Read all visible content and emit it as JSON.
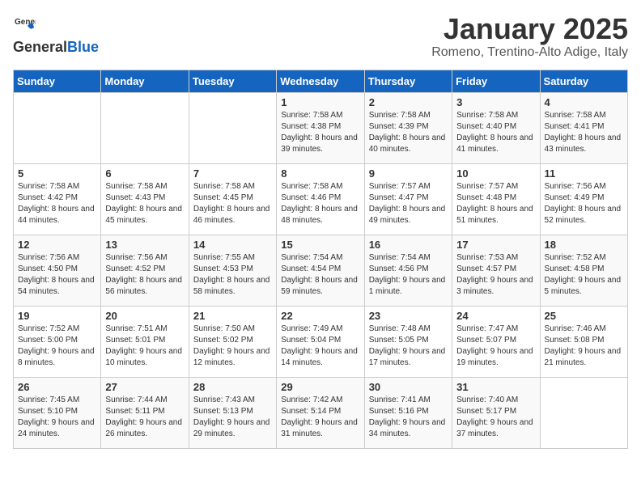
{
  "logo": {
    "general": "General",
    "blue": "Blue"
  },
  "title": "January 2025",
  "subtitle": "Romeno, Trentino-Alto Adige, Italy",
  "days_header": [
    "Sunday",
    "Monday",
    "Tuesday",
    "Wednesday",
    "Thursday",
    "Friday",
    "Saturday"
  ],
  "weeks": [
    [
      {
        "day": "",
        "sunrise": "",
        "sunset": "",
        "daylight": ""
      },
      {
        "day": "",
        "sunrise": "",
        "sunset": "",
        "daylight": ""
      },
      {
        "day": "",
        "sunrise": "",
        "sunset": "",
        "daylight": ""
      },
      {
        "day": "1",
        "sunrise": "Sunrise: 7:58 AM",
        "sunset": "Sunset: 4:38 PM",
        "daylight": "Daylight: 8 hours and 39 minutes."
      },
      {
        "day": "2",
        "sunrise": "Sunrise: 7:58 AM",
        "sunset": "Sunset: 4:39 PM",
        "daylight": "Daylight: 8 hours and 40 minutes."
      },
      {
        "day": "3",
        "sunrise": "Sunrise: 7:58 AM",
        "sunset": "Sunset: 4:40 PM",
        "daylight": "Daylight: 8 hours and 41 minutes."
      },
      {
        "day": "4",
        "sunrise": "Sunrise: 7:58 AM",
        "sunset": "Sunset: 4:41 PM",
        "daylight": "Daylight: 8 hours and 43 minutes."
      }
    ],
    [
      {
        "day": "5",
        "sunrise": "Sunrise: 7:58 AM",
        "sunset": "Sunset: 4:42 PM",
        "daylight": "Daylight: 8 hours and 44 minutes."
      },
      {
        "day": "6",
        "sunrise": "Sunrise: 7:58 AM",
        "sunset": "Sunset: 4:43 PM",
        "daylight": "Daylight: 8 hours and 45 minutes."
      },
      {
        "day": "7",
        "sunrise": "Sunrise: 7:58 AM",
        "sunset": "Sunset: 4:45 PM",
        "daylight": "Daylight: 8 hours and 46 minutes."
      },
      {
        "day": "8",
        "sunrise": "Sunrise: 7:58 AM",
        "sunset": "Sunset: 4:46 PM",
        "daylight": "Daylight: 8 hours and 48 minutes."
      },
      {
        "day": "9",
        "sunrise": "Sunrise: 7:57 AM",
        "sunset": "Sunset: 4:47 PM",
        "daylight": "Daylight: 8 hours and 49 minutes."
      },
      {
        "day": "10",
        "sunrise": "Sunrise: 7:57 AM",
        "sunset": "Sunset: 4:48 PM",
        "daylight": "Daylight: 8 hours and 51 minutes."
      },
      {
        "day": "11",
        "sunrise": "Sunrise: 7:56 AM",
        "sunset": "Sunset: 4:49 PM",
        "daylight": "Daylight: 8 hours and 52 minutes."
      }
    ],
    [
      {
        "day": "12",
        "sunrise": "Sunrise: 7:56 AM",
        "sunset": "Sunset: 4:50 PM",
        "daylight": "Daylight: 8 hours and 54 minutes."
      },
      {
        "day": "13",
        "sunrise": "Sunrise: 7:56 AM",
        "sunset": "Sunset: 4:52 PM",
        "daylight": "Daylight: 8 hours and 56 minutes."
      },
      {
        "day": "14",
        "sunrise": "Sunrise: 7:55 AM",
        "sunset": "Sunset: 4:53 PM",
        "daylight": "Daylight: 8 hours and 58 minutes."
      },
      {
        "day": "15",
        "sunrise": "Sunrise: 7:54 AM",
        "sunset": "Sunset: 4:54 PM",
        "daylight": "Daylight: 8 hours and 59 minutes."
      },
      {
        "day": "16",
        "sunrise": "Sunrise: 7:54 AM",
        "sunset": "Sunset: 4:56 PM",
        "daylight": "Daylight: 9 hours and 1 minute."
      },
      {
        "day": "17",
        "sunrise": "Sunrise: 7:53 AM",
        "sunset": "Sunset: 4:57 PM",
        "daylight": "Daylight: 9 hours and 3 minutes."
      },
      {
        "day": "18",
        "sunrise": "Sunrise: 7:52 AM",
        "sunset": "Sunset: 4:58 PM",
        "daylight": "Daylight: 9 hours and 5 minutes."
      }
    ],
    [
      {
        "day": "19",
        "sunrise": "Sunrise: 7:52 AM",
        "sunset": "Sunset: 5:00 PM",
        "daylight": "Daylight: 9 hours and 8 minutes."
      },
      {
        "day": "20",
        "sunrise": "Sunrise: 7:51 AM",
        "sunset": "Sunset: 5:01 PM",
        "daylight": "Daylight: 9 hours and 10 minutes."
      },
      {
        "day": "21",
        "sunrise": "Sunrise: 7:50 AM",
        "sunset": "Sunset: 5:02 PM",
        "daylight": "Daylight: 9 hours and 12 minutes."
      },
      {
        "day": "22",
        "sunrise": "Sunrise: 7:49 AM",
        "sunset": "Sunset: 5:04 PM",
        "daylight": "Daylight: 9 hours and 14 minutes."
      },
      {
        "day": "23",
        "sunrise": "Sunrise: 7:48 AM",
        "sunset": "Sunset: 5:05 PM",
        "daylight": "Daylight: 9 hours and 17 minutes."
      },
      {
        "day": "24",
        "sunrise": "Sunrise: 7:47 AM",
        "sunset": "Sunset: 5:07 PM",
        "daylight": "Daylight: 9 hours and 19 minutes."
      },
      {
        "day": "25",
        "sunrise": "Sunrise: 7:46 AM",
        "sunset": "Sunset: 5:08 PM",
        "daylight": "Daylight: 9 hours and 21 minutes."
      }
    ],
    [
      {
        "day": "26",
        "sunrise": "Sunrise: 7:45 AM",
        "sunset": "Sunset: 5:10 PM",
        "daylight": "Daylight: 9 hours and 24 minutes."
      },
      {
        "day": "27",
        "sunrise": "Sunrise: 7:44 AM",
        "sunset": "Sunset: 5:11 PM",
        "daylight": "Daylight: 9 hours and 26 minutes."
      },
      {
        "day": "28",
        "sunrise": "Sunrise: 7:43 AM",
        "sunset": "Sunset: 5:13 PM",
        "daylight": "Daylight: 9 hours and 29 minutes."
      },
      {
        "day": "29",
        "sunrise": "Sunrise: 7:42 AM",
        "sunset": "Sunset: 5:14 PM",
        "daylight": "Daylight: 9 hours and 31 minutes."
      },
      {
        "day": "30",
        "sunrise": "Sunrise: 7:41 AM",
        "sunset": "Sunset: 5:16 PM",
        "daylight": "Daylight: 9 hours and 34 minutes."
      },
      {
        "day": "31",
        "sunrise": "Sunrise: 7:40 AM",
        "sunset": "Sunset: 5:17 PM",
        "daylight": "Daylight: 9 hours and 37 minutes."
      },
      {
        "day": "",
        "sunrise": "",
        "sunset": "",
        "daylight": ""
      }
    ]
  ]
}
